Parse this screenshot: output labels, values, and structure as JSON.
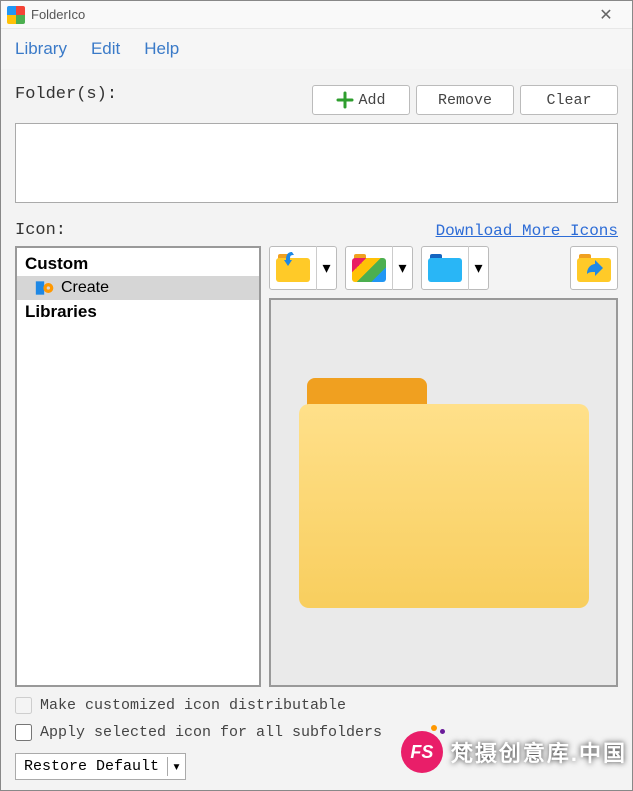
{
  "titlebar": {
    "title": "FolderIco"
  },
  "menubar": {
    "items": [
      "Library",
      "Edit",
      "Help"
    ]
  },
  "labels": {
    "folders": "Folder(s):",
    "icon": "Icon:"
  },
  "buttons": {
    "add": "Add",
    "remove": "Remove",
    "clear": "Clear",
    "restore": "Restore Default"
  },
  "link": {
    "download": "Download More Icons"
  },
  "sidebar": {
    "custom_header": "Custom",
    "create": "Create",
    "libraries_header": "Libraries"
  },
  "checkboxes": {
    "distributable": "Make customized icon distributable",
    "subfolders": "Apply selected icon for all subfolders"
  },
  "watermark": {
    "badge": "FS",
    "text": "梵摄创意库.中国"
  }
}
